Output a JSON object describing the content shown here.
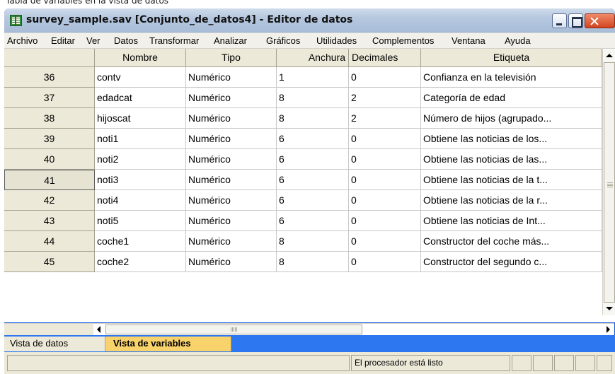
{
  "background_caption": "Tabla de variables en la vista de datos",
  "window": {
    "title": "survey_sample.sav [Conjunto_de_datos4] - Editor de datos",
    "controls": [
      "minimize-icon",
      "maximize-icon",
      "close-icon"
    ]
  },
  "menu": [
    {
      "label": "Archivo"
    },
    {
      "label": "Editar"
    },
    {
      "label": "Ver"
    },
    {
      "label": "Datos"
    },
    {
      "label": "Transformar"
    },
    {
      "label": "Analizar"
    },
    {
      "label": "Gráficos"
    },
    {
      "label": "Utilidades"
    },
    {
      "label": "Complementos"
    },
    {
      "label": "Ventana"
    },
    {
      "label": "Ayuda"
    }
  ],
  "columns": [
    "Nombre",
    "Tipo",
    "Anchura",
    "Decimales",
    "Etiqueta"
  ],
  "rows": [
    {
      "num": "36",
      "nombre": "contv",
      "tipo": "Numérico",
      "anchura": "1",
      "decimales": "0",
      "etiqueta": "Confianza en la televisión"
    },
    {
      "num": "37",
      "nombre": "edadcat",
      "tipo": "Numérico",
      "anchura": "8",
      "decimales": "2",
      "etiqueta": "Categoría de edad"
    },
    {
      "num": "38",
      "nombre": "hijoscat",
      "tipo": "Numérico",
      "anchura": "8",
      "decimales": "2",
      "etiqueta": "Número de hijos (agrupado..."
    },
    {
      "num": "39",
      "nombre": "noti1",
      "tipo": "Numérico",
      "anchura": "6",
      "decimales": "0",
      "etiqueta": "Obtiene las noticias de los..."
    },
    {
      "num": "40",
      "nombre": "noti2",
      "tipo": "Numérico",
      "anchura": "6",
      "decimales": "0",
      "etiqueta": "Obtiene las noticias de las..."
    },
    {
      "num": "41",
      "nombre": "noti3",
      "tipo": "Numérico",
      "anchura": "6",
      "decimales": "0",
      "etiqueta": "Obtiene las noticias de la t..."
    },
    {
      "num": "42",
      "nombre": "noti4",
      "tipo": "Numérico",
      "anchura": "6",
      "decimales": "0",
      "etiqueta": "Obtiene las noticias de la r..."
    },
    {
      "num": "43",
      "nombre": "noti5",
      "tipo": "Numérico",
      "anchura": "6",
      "decimales": "0",
      "etiqueta": "Obtiene las noticias de Int..."
    },
    {
      "num": "44",
      "nombre": "coche1",
      "tipo": "Numérico",
      "anchura": "8",
      "decimales": "0",
      "etiqueta": "Constructor del coche más..."
    },
    {
      "num": "45",
      "nombre": "coche2",
      "tipo": "Numérico",
      "anchura": "8",
      "decimales": "0",
      "etiqueta": "Constructor del segundo c..."
    }
  ],
  "selected_row": "41",
  "tabs": {
    "data_view": "Vista de datos",
    "variable_view": "Vista de variables",
    "active": "Vista de variables"
  },
  "status": {
    "processor": "El procesador está listo"
  },
  "colors": {
    "title_bar": "#b6c8df",
    "tab_strip": "#2d78f0",
    "active_tab": "#f8d36b",
    "close_button": "#d3441f"
  }
}
